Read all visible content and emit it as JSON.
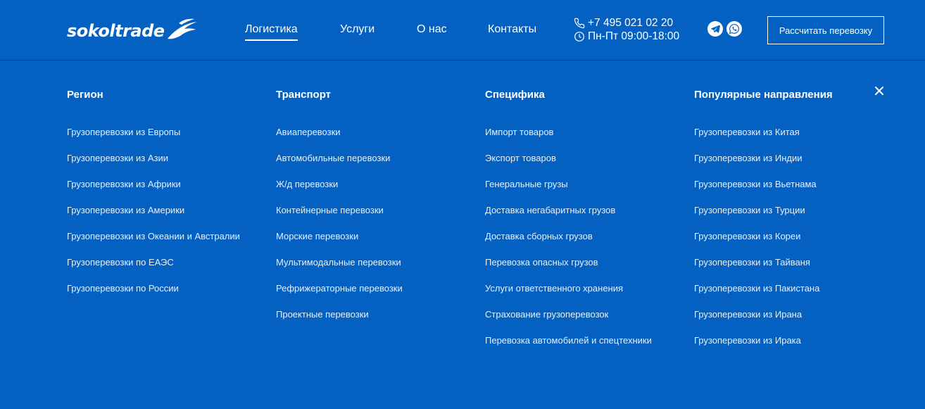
{
  "header": {
    "logo_text": "sokoltrade",
    "nav": [
      {
        "label": "Логистика",
        "active": true
      },
      {
        "label": "Услуги"
      },
      {
        "label": "О нас"
      },
      {
        "label": "Контакты"
      }
    ],
    "phone": "+7 495 021 02 20",
    "hours": "Пн-Пт 09:00-18:00",
    "social_icons": [
      "telegram-icon",
      "whatsapp-icon"
    ],
    "cta_label": "Рассчитать перевозку"
  },
  "menu": {
    "columns": [
      {
        "title": "Регион",
        "items": [
          "Грузоперевозки из Европы",
          "Грузоперевозки из Азии",
          "Грузоперевозки из Африки",
          "Грузоперевозки из Америки",
          "Грузоперевозки из Океании и Австралии",
          "Грузоперевозки по ЕАЭС",
          "Грузоперевозки по России"
        ]
      },
      {
        "title": "Транспорт",
        "items": [
          "Авиаперевозки",
          "Автомобильные перевозки",
          "Ж/д перевозки",
          "Контейнерные перевозки",
          "Морские перевозки",
          "Мультимодальные перевозки",
          "Рефрижераторные перевозки",
          "Проектные перевозки"
        ]
      },
      {
        "title": "Специфика",
        "items": [
          "Импорт товаров",
          "Экспорт товаров",
          "Генеральные грузы",
          "Доставка негабаритных грузов",
          "Доставка сборных грузов",
          "Перевозка опасных грузов",
          "Услуги ответственного хранения",
          "Страхование грузоперевозок",
          "Перевозка автомобилей и спецтехники"
        ]
      },
      {
        "title": "Популярные направления",
        "items": [
          "Грузоперевозки из Китая",
          "Грузоперевозки из Индии",
          "Грузоперевозки из Вьетнама",
          "Грузоперевозки из Турции",
          "Грузоперевозки из Кореи",
          "Грузоперевозки из Тайваня",
          "Грузоперевозки из Пакистана",
          "Грузоперевозки из Ирана",
          "Грузоперевозки из Ирака"
        ]
      }
    ]
  },
  "colors": {
    "background": "#0461c2",
    "divider": "#0a3f7a",
    "text": "#ffffff"
  }
}
